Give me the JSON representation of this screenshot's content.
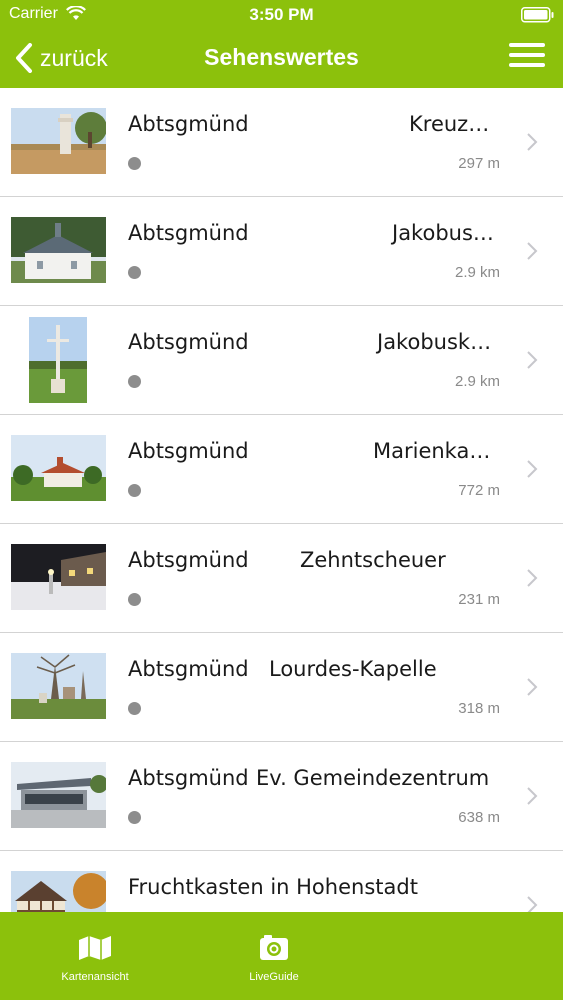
{
  "status_bar": {
    "carrier": "Carrier",
    "time": "3:50 PM"
  },
  "nav": {
    "back_label": "zurück",
    "title": "Sehenswertes"
  },
  "list": [
    {
      "place": "Abtsgmünd",
      "title": "Kreuz…",
      "distance": "297 m",
      "image": "wayside-cross-field"
    },
    {
      "place": "Abtsgmünd",
      "title": "Jakobus…",
      "distance": "2.9 km",
      "image": "chapel-with-trees"
    },
    {
      "place": "Abtsgmünd",
      "title": "Jakobusk…",
      "distance": "2.9 km",
      "image": "cross-meadow"
    },
    {
      "place": "Abtsgmünd",
      "title": "Marienka…",
      "distance": "772 m",
      "image": "chapel-landscape"
    },
    {
      "place": "Abtsgmünd",
      "title": "Zehntscheuer",
      "distance": "231 m",
      "image": "barn-night"
    },
    {
      "place": "Abtsgmünd",
      "title": "Lourdes-Kapelle",
      "distance": "318 m",
      "image": "grotto-trees"
    },
    {
      "place": "Abtsgmünd",
      "title": "Ev. Gemeindezentrum",
      "distance": "638 m",
      "image": "community-center"
    },
    {
      "place": "",
      "title": "Fruchtkasten in Hohenstadt",
      "distance": "",
      "image": "half-timbered-house"
    }
  ],
  "tabs": [
    {
      "label": "Kartenansicht",
      "icon": "map-icon"
    },
    {
      "label": "LiveGuide",
      "icon": "camera-icon"
    }
  ],
  "colors": {
    "accent": "#8cc10c",
    "separator": "#d3d3d3",
    "dot": "#8d8d8d",
    "distance": "#8a8a8a"
  }
}
